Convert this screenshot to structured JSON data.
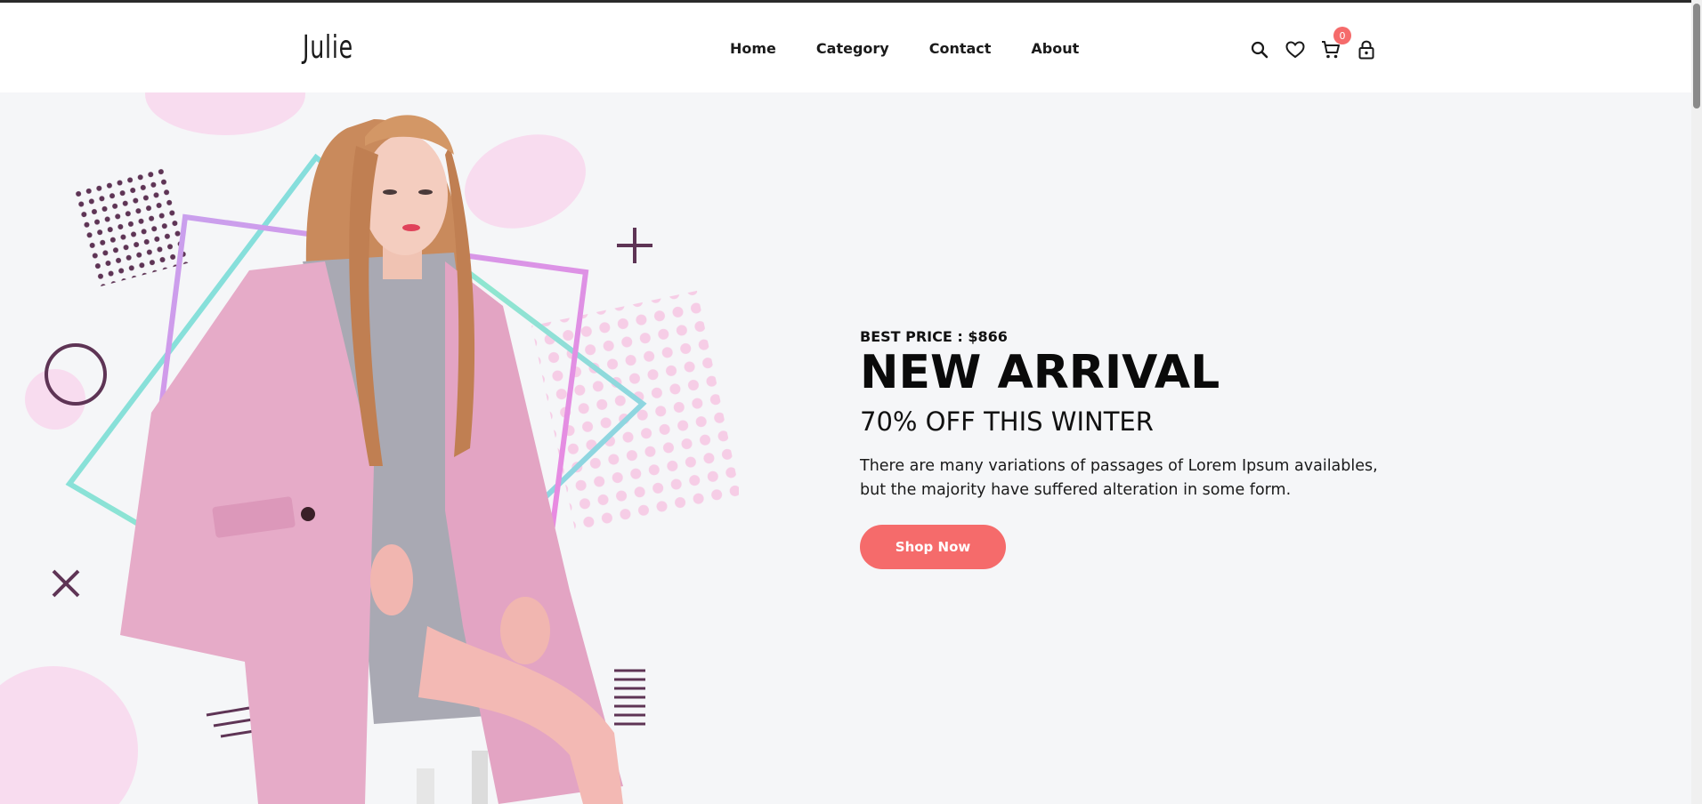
{
  "brand": {
    "logo_text": "Julie"
  },
  "nav": {
    "items": [
      {
        "label": "Home"
      },
      {
        "label": "Category"
      },
      {
        "label": "Contact"
      },
      {
        "label": "About"
      }
    ]
  },
  "header_icons": {
    "search": "search-icon",
    "wishlist": "heart-icon",
    "cart": "cart-icon",
    "cart_count": "0",
    "account": "lock-icon"
  },
  "hero": {
    "best_price": "BEST PRICE : $866",
    "title": "NEW ARRIVAL",
    "subtitle": "70% OFF THIS WINTER",
    "description": "There are many variations of passages of Lorem Ipsum availables, but the majority have suffered alteration in some form.",
    "cta_label": "Shop Now"
  },
  "colors": {
    "accent": "#f56b6b",
    "background": "#f5f6f8",
    "header_bg": "#ffffff",
    "coat_pink": "#e5a9c6",
    "shape_purple": "#6a3f5e"
  }
}
